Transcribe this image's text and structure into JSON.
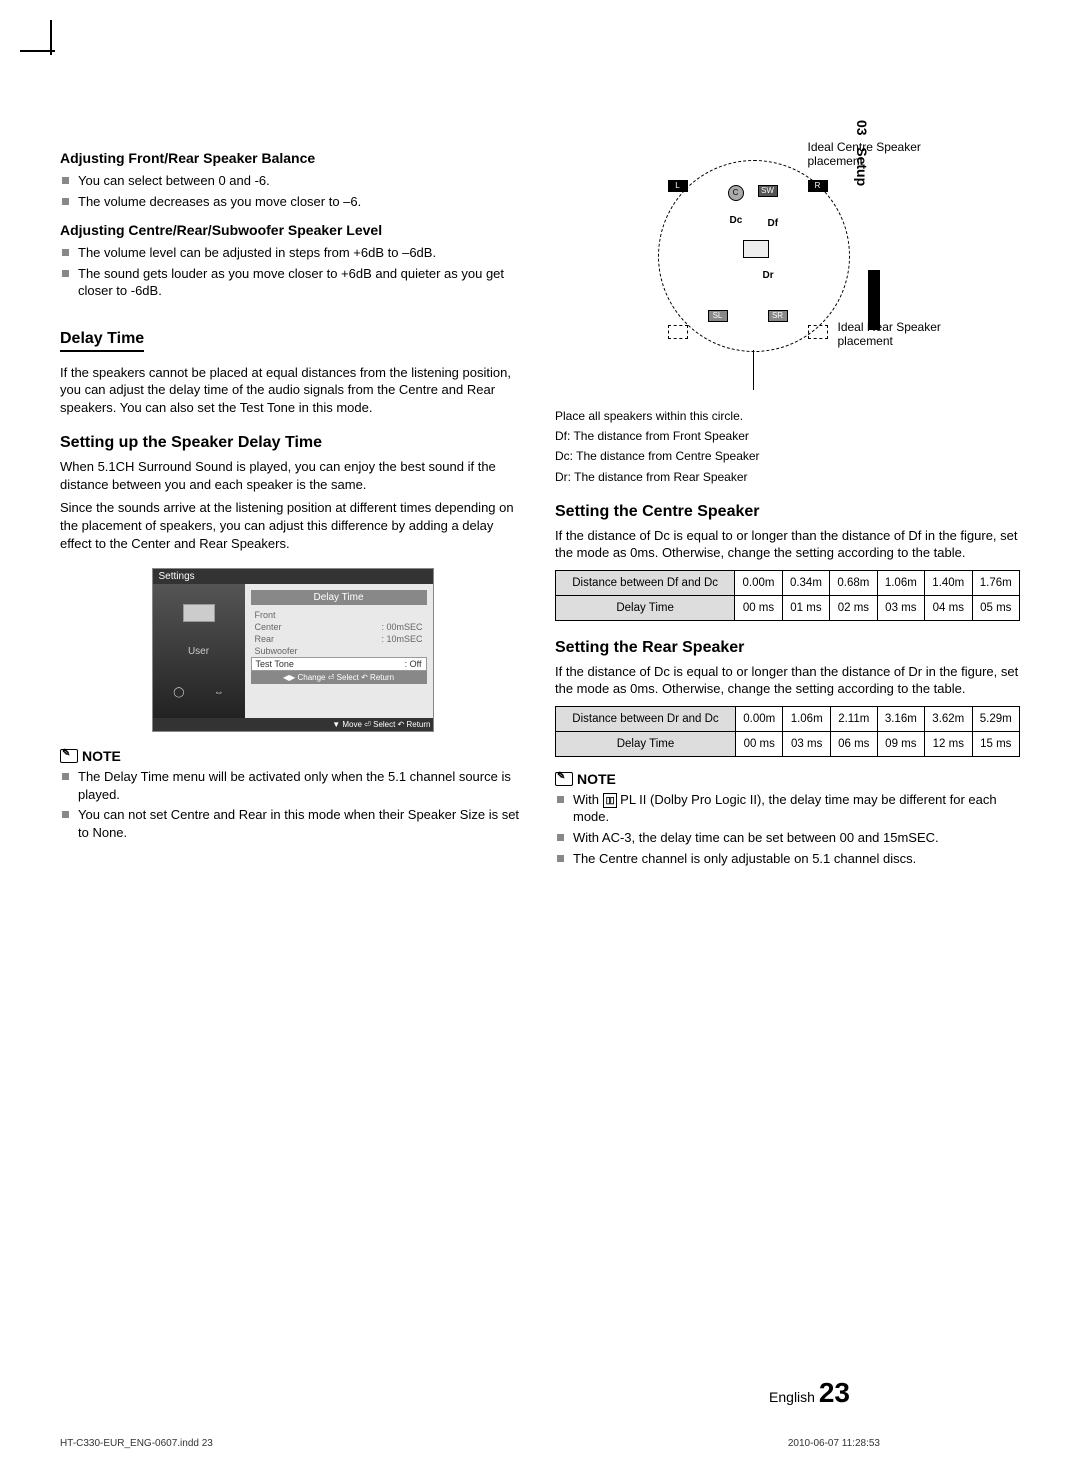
{
  "sidebar": {
    "chapter": "03",
    "section": "Setup"
  },
  "left": {
    "h1": "Adjusting Front/Rear Speaker Balance",
    "b1": [
      "You can select between 0 and -6.",
      "The volume decreases as you move closer to –6."
    ],
    "h2": "Adjusting Centre/Rear/Subwoofer Speaker Level",
    "b2": [
      "The volume level can be adjusted in steps from +6dB to –6dB.",
      "The sound gets louder as you move closer to +6dB and quieter as you get closer to -6dB."
    ],
    "h3": "Delay Time",
    "p3": "If the speakers cannot be placed at equal distances from the listening position, you can adjust the delay time of the audio signals from the Centre and  Rear speakers. You can also set the Test Tone in this mode.",
    "h4": "Setting up the Speaker Delay Time",
    "p4a": "When 5.1CH Surround Sound is played, you can enjoy the best sound if the distance between you and each speaker is the same.",
    "p4b": "Since the sounds arrive at the listening position at different times depending on the placement of speakers, you can adjust this difference by adding a delay effect to the Center and Rear Speakers.",
    "screenshot": {
      "title": "Settings",
      "header": "Delay Time",
      "user": "User",
      "rows": [
        {
          "k": "Front",
          "v": ""
        },
        {
          "k": "Center",
          "v": ": 00mSEC"
        },
        {
          "k": "Rear",
          "v": ": 10mSEC"
        },
        {
          "k": "Subwoofer",
          "v": ""
        },
        {
          "k": "Test Tone",
          "v": ": Off"
        }
      ],
      "footer1": "◀▶ Change     ⏎ Select     ↶ Return",
      "footer2": "▼ Move     ⏎ Select     ↶ Return"
    },
    "noteLabel": "NOTE",
    "notes": [
      "The Delay Time menu will be activated only when the 5.1 channel source is played.",
      "You can not set Centre and Rear in this mode when their Speaker Size is set to None."
    ]
  },
  "right": {
    "diag": {
      "idealCentre": "Ideal Centre Speaker placement",
      "idealRear": "Ideal Rear Speaker placement",
      "L": "L",
      "R": "R",
      "C": "C",
      "SW": "SW",
      "Dc": "Dc",
      "Df": "Df",
      "Dr": "Dr",
      "SL": "SL",
      "SR": "SR"
    },
    "cap1": "Place all speakers within this circle.",
    "cap2": "Df: The distance from Front Speaker",
    "cap3": "Dc: The distance from Centre Speaker",
    "cap4": "Dr: The distance from Rear Speaker",
    "h5": "Setting the Centre Speaker",
    "p5": "If the distance of Dc is equal to or longer than the distance of Df in the figure, set the mode as 0ms. Otherwise, change the setting according to the table.",
    "table1": {
      "r1h": "Distance between Df and Dc",
      "r1": [
        "0.00m",
        "0.34m",
        "0.68m",
        "1.06m",
        "1.40m",
        "1.76m"
      ],
      "r2h": "Delay Time",
      "r2": [
        "00 ms",
        "01 ms",
        "02 ms",
        "03 ms",
        "04 ms",
        "05 ms"
      ]
    },
    "h6": "Setting the Rear Speaker",
    "p6": "If the distance of Dc is equal to or longer than the distance of Dr in the figure, set the mode as 0ms. Otherwise, change the setting according to the table.",
    "table2": {
      "r1h": "Distance between Dr and Dc",
      "r1": [
        "0.00m",
        "1.06m",
        "2.11m",
        "3.16m",
        "3.62m",
        "5.29m"
      ],
      "r2h": "Delay Time",
      "r2": [
        "00 ms",
        "03 ms",
        "06 ms",
        "09 ms",
        "12 ms",
        "15 ms"
      ]
    },
    "noteLabel": "NOTE",
    "n1a": "With ",
    "n1b": " PL II (Dolby Pro Logic II), the delay time may be different for each mode.",
    "notes": [
      "With AC-3, the delay time can be set between 00 and 15mSEC.",
      "The Centre channel is only adjustable on 5.1 channel discs."
    ]
  },
  "footer": {
    "lang": "English",
    "page": "23"
  },
  "meta": {
    "file": "HT-C330-EUR_ENG-0607.indd   23",
    "date": "2010-06-07   11:28:53"
  }
}
